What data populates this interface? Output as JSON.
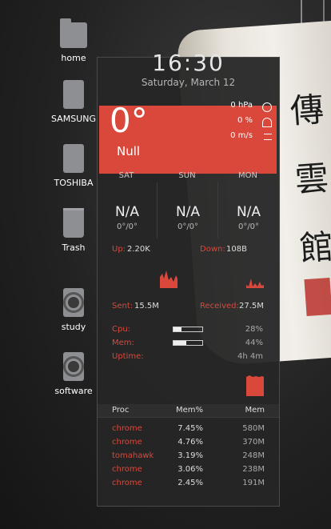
{
  "desktop": {
    "icons": [
      {
        "label": "home",
        "type": "folder"
      },
      {
        "label": "SAMSUNG",
        "type": "drive"
      },
      {
        "label": "TOSHIBA",
        "type": "drive"
      },
      {
        "label": "Trash",
        "type": "trash"
      },
      {
        "label": "study",
        "type": "disc"
      },
      {
        "label": "software",
        "type": "disc"
      }
    ],
    "wallpaper_glyphs": "傳 雲 館"
  },
  "widget": {
    "clock": "16:30",
    "date": "Saturday, March 12",
    "accent": "#d9483b",
    "weather": {
      "temperature": "0°",
      "condition": "Null",
      "pressure": "0 hPa",
      "humidity": "0 %",
      "wind": "0 m/s",
      "icons": [
        "pressure-gauge-icon",
        "humidity-icon",
        "wind-icon"
      ]
    },
    "forecast": [
      {
        "day": "SAT",
        "state": "N/A",
        "range": "0°/0°"
      },
      {
        "day": "SUN",
        "state": "N/A",
        "range": "0°/0°"
      },
      {
        "day": "MON",
        "state": "N/A",
        "range": "0°/0°"
      }
    ],
    "network": {
      "up_label": "Up:",
      "up_value": "2.20K",
      "down_label": "Down:",
      "down_value": "108B",
      "sent_label": "Sent:",
      "sent_value": "15.5M",
      "received_label": "Received:",
      "received_value": "27.5M"
    },
    "system": {
      "cpu_label": "Cpu:",
      "cpu_value": "28%",
      "cpu_fraction": 0.28,
      "mem_label": "Mem:",
      "mem_value": "44%",
      "mem_fraction": 0.44,
      "uptime_label": "Uptime:",
      "uptime_value": "4h 4m"
    },
    "processes": {
      "headers": [
        "Proc",
        "Mem%",
        "Mem"
      ],
      "rows": [
        {
          "name": "chrome",
          "pct": "7.45%",
          "mem": "580M"
        },
        {
          "name": "chrome",
          "pct": "4.76%",
          "mem": "370M"
        },
        {
          "name": "tomahawk",
          "pct": "3.19%",
          "mem": "248M"
        },
        {
          "name": "chrome",
          "pct": "3.06%",
          "mem": "238M"
        },
        {
          "name": "chrome",
          "pct": "2.45%",
          "mem": "191M"
        }
      ]
    }
  }
}
